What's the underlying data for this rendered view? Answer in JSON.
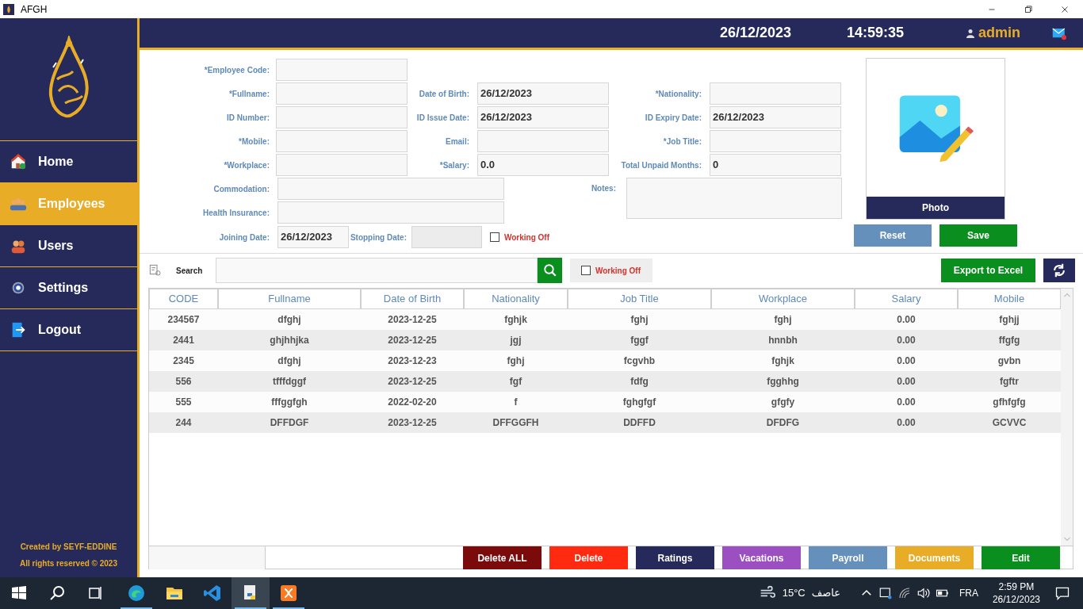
{
  "window": {
    "title": "AFGH"
  },
  "sidebar": {
    "items": [
      {
        "label": "Home",
        "selected": false
      },
      {
        "label": "Employees",
        "selected": true
      },
      {
        "label": "Users",
        "selected": false
      },
      {
        "label": "Settings",
        "selected": false
      },
      {
        "label": "Logout",
        "selected": false
      }
    ],
    "footer": [
      "Created by SEYF-EDDINE",
      "All rights reserved © 2023"
    ]
  },
  "header": {
    "date": "26/12/2023",
    "time": "14:59:35",
    "user": "admin"
  },
  "form": {
    "rows": [
      [
        {
          "label": "*Employee Code:"
        }
      ],
      [
        {
          "label": "*Fullname:"
        },
        {
          "label": "Date of Birth:",
          "value": "26/12/2023"
        },
        {
          "label": "*Nationality:"
        }
      ],
      [
        {
          "label": "ID Number:"
        },
        {
          "label": "ID Issue Date:",
          "value": "26/12/2023"
        },
        {
          "label": "ID Expiry Date:",
          "value": "26/12/2023"
        }
      ],
      [
        {
          "label": "*Mobile:"
        },
        {
          "label": "Email:"
        },
        {
          "label": "*Job Title:"
        }
      ],
      [
        {
          "label": "*Workplace:"
        },
        {
          "label": "*Salary:",
          "value": "0.0"
        },
        {
          "label": "Total Unpaid Months:",
          "value": "0"
        }
      ]
    ],
    "commodation": {
      "label": "Commodation:"
    },
    "health_insurance": {
      "label": "Health Insurance:"
    },
    "notes": {
      "label": "Notes:"
    },
    "joining_date": {
      "label": "Joining Date:",
      "value": "26/12/2023"
    },
    "stopping_date": {
      "label": "Stopping Date:",
      "disabled": true
    },
    "working_off": {
      "label": "Working Off",
      "checked": false
    }
  },
  "photo": {
    "label": "Photo"
  },
  "form_buttons": [
    {
      "label": "Reset",
      "color": "#6590bb"
    },
    {
      "label": "Save",
      "color": "#0a8f1e"
    }
  ],
  "toolbar": {
    "search_label": "Search",
    "working_off": {
      "label": "Working Off",
      "checked": false
    },
    "export_button": "Export to Excel"
  },
  "table": {
    "columns": [
      "CODE",
      "Fullname",
      "Date of Birth",
      "Nationality",
      "Job Title",
      "Workplace",
      "Salary",
      "Mobile"
    ],
    "rows": [
      [
        "234567",
        "dfghj",
        "2023-12-25",
        "fghjk",
        "fghj",
        "fghj",
        "0.00",
        "fghjj"
      ],
      [
        "2441",
        "ghjhhjka",
        "2023-12-25",
        "jgj",
        "fggf",
        "hnnbh",
        "0.00",
        "ffgfg"
      ],
      [
        "2345",
        "dfghj",
        "2023-12-23",
        "fghj",
        "fcgvhb",
        "fghjk",
        "0.00",
        "gvbn"
      ],
      [
        "556",
        "tfffdggf",
        "2023-12-25",
        "fgf",
        "fdfg",
        "fgghhg",
        "0.00",
        "fgftr"
      ],
      [
        "555",
        "fffggfgh",
        "2022-02-20",
        "f",
        "fghgfgf",
        "gfgfy",
        "0.00",
        "gfhfgfg"
      ],
      [
        "244",
        "DFFDGF",
        "2023-12-25",
        "DFFGGFH",
        "DDFFD",
        "DFDFG",
        "0.00",
        "GCVVC"
      ]
    ]
  },
  "actions": [
    {
      "label": "Delete ALL",
      "color": "#7b0a0a"
    },
    {
      "label": "Delete",
      "color": "#ff2a10"
    },
    {
      "label": "Ratings",
      "color": "#262a5b"
    },
    {
      "label": "Vacations",
      "color": "#9b4fc0"
    },
    {
      "label": "Payroll",
      "color": "#6590bb"
    },
    {
      "label": "Documents",
      "color": "#e8ac26"
    },
    {
      "label": "Edit",
      "color": "#0a8f1e"
    }
  ],
  "taskbar": {
    "apps": [
      {
        "running": true,
        "selected": false
      },
      {
        "running": false,
        "selected": false
      },
      {
        "running": false,
        "selected": false
      },
      {
        "running": true,
        "selected": true
      },
      {
        "running": true,
        "selected": false
      }
    ],
    "weather": {
      "temperature": "15°C",
      "condition": "عاصف"
    },
    "language": "FRA",
    "time": "2:59 PM",
    "date": "26/12/2023"
  }
}
